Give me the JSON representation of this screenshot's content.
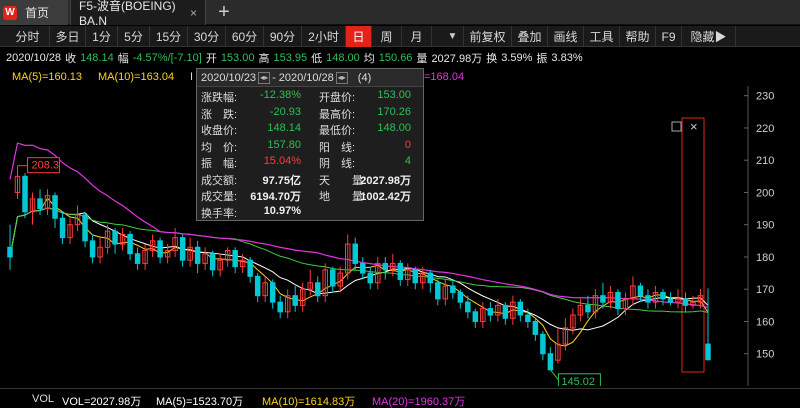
{
  "tabs": [
    {
      "label": "首页",
      "logo": "W"
    },
    {
      "label": "F5-波音(BOEING) BA.N",
      "close": "×"
    }
  ],
  "tab_add": "+",
  "toolbar": [
    {
      "label": "分时"
    },
    {
      "label": "多日"
    },
    {
      "label": "1分"
    },
    {
      "label": "5分"
    },
    {
      "label": "15分"
    },
    {
      "label": "30分"
    },
    {
      "label": "60分"
    },
    {
      "label": "90分"
    },
    {
      "label": "2小时"
    },
    {
      "label": "日",
      "active": true
    },
    {
      "label": "周"
    },
    {
      "label": "月"
    },
    {
      "label": "▼"
    },
    {
      "label": "前复权"
    },
    {
      "label": "叠加"
    },
    {
      "label": "画线"
    },
    {
      "label": "工具"
    },
    {
      "label": "帮助"
    },
    {
      "label": "F9"
    },
    {
      "label": "隐藏▶"
    }
  ],
  "quote": {
    "date": "2020/10/28",
    "close_label": "收",
    "close": "148.14",
    "change_label": "幅",
    "change": "-4.57%/[-7.10]",
    "open_label": "开",
    "open": "153.00",
    "high_label": "高",
    "high": "153.95",
    "low_label": "低",
    "low": "148.00",
    "avg_label": "均",
    "avg": "150.66",
    "vol_label": "量",
    "vol": "2027.98万",
    "turnover_label": "换",
    "turnover": "3.59%",
    "amp_label": "振",
    "amp": "3.83%"
  },
  "ma": {
    "ma5": "MA(5)=160.13",
    "ma10": "MA(10)=163.04",
    "ma_hidden_prefix": "I",
    "ma20": "=168.04"
  },
  "popup": {
    "range_start": "2020/10/23",
    "range_end": "2020/10/28",
    "dash": "-",
    "count": "(4)",
    "rows": [
      {
        "k1": "涨跌幅:",
        "v1": "-12.38%",
        "c1": "g",
        "k2": "开盘价:",
        "v2": "153.00",
        "c2": "g"
      },
      {
        "k1": "涨　跌:",
        "v1": "-20.93",
        "c1": "g",
        "k2": "最高价:",
        "v2": "170.26",
        "c2": "g"
      },
      {
        "k1": "收盘价:",
        "v1": "148.14",
        "c1": "g",
        "k2": "最低价:",
        "v2": "148.00",
        "c2": "g"
      },
      {
        "k1": "均　价:",
        "v1": "157.80",
        "c1": "g",
        "k2": "阳　线:",
        "v2": "0",
        "c2": "r"
      },
      {
        "k1": "振　幅:",
        "v1": "15.04%",
        "c1": "r",
        "k2": "阴　线:",
        "v2": "4",
        "c2": "g"
      },
      {
        "k1": "成交额:",
        "v1": "97.75亿",
        "c1": "w",
        "k2": "天　　量:",
        "v2": "2027.98万",
        "c2": "w"
      },
      {
        "k1": "成交量:",
        "v1": "6194.70万",
        "c1": "w",
        "k2": "地　　量:",
        "v2": "1002.42万",
        "c2": "w"
      },
      {
        "k1": "换手率:",
        "v1": "10.97%",
        "c1": "w",
        "k2": "",
        "v2": "",
        "c2": "w"
      }
    ]
  },
  "vol": {
    "label": "VOL",
    "vol": "VOL=2027.98万",
    "ma5": "MA(5)=1523.70万",
    "ma10": "MA(10)=1614.83万",
    "ma20": "MA(20)=1960.37万"
  },
  "colors": {
    "up": "#ff3b3b",
    "down": "#00c8d4",
    "ma5": "#ffffff",
    "ma10": "#ffd21f",
    "ma20": "#e633e6",
    "ma60": "#3fcf3f",
    "accent": "#e2231a"
  },
  "chart_data": {
    "type": "candlestick",
    "ylim": [
      140,
      233
    ],
    "yticks": [
      150,
      160,
      170,
      180,
      190,
      200,
      210,
      220,
      230
    ],
    "high_label": "208.3",
    "low_label": "145.02",
    "selection_icons": [
      "□",
      "×"
    ],
    "candles": [
      [
        183,
        180,
        190,
        176
      ],
      [
        200,
        205,
        208.3,
        198
      ],
      [
        205,
        194,
        206,
        192
      ],
      [
        194,
        198,
        200,
        190
      ],
      [
        198,
        195,
        201,
        193
      ],
      [
        195,
        199,
        201,
        193
      ],
      [
        199,
        192,
        200,
        189
      ],
      [
        192,
        186,
        194,
        184
      ],
      [
        186,
        190,
        192,
        184
      ],
      [
        190,
        193,
        196,
        188
      ],
      [
        193,
        185,
        194,
        183
      ],
      [
        185,
        180,
        187,
        178
      ],
      [
        180,
        183,
        186,
        178
      ],
      [
        183,
        188,
        190,
        181
      ],
      [
        188,
        184,
        189,
        181
      ],
      [
        184,
        187,
        189,
        182
      ],
      [
        187,
        181,
        188,
        179
      ],
      [
        181,
        178,
        183,
        176
      ],
      [
        178,
        182,
        184,
        176
      ],
      [
        182,
        185,
        187,
        180
      ],
      [
        185,
        180,
        186,
        178
      ],
      [
        180,
        182,
        184,
        178
      ],
      [
        182,
        186,
        189,
        180
      ],
      [
        186,
        179,
        187,
        177
      ],
      [
        179,
        183,
        186,
        177
      ],
      [
        183,
        178,
        185,
        175
      ],
      [
        178,
        181,
        183,
        176
      ],
      [
        181,
        176,
        182,
        174
      ],
      [
        176,
        179,
        181,
        174
      ],
      [
        179,
        182,
        183,
        177
      ],
      [
        182,
        177,
        183,
        175
      ],
      [
        177,
        179,
        181,
        175
      ],
      [
        179,
        174,
        180,
        172
      ],
      [
        174,
        168,
        175,
        166
      ],
      [
        168,
        172,
        174,
        166
      ],
      [
        172,
        166,
        173,
        164
      ],
      [
        166,
        163,
        168,
        161
      ],
      [
        163,
        168,
        170,
        161
      ],
      [
        168,
        165,
        171,
        163
      ],
      [
        165,
        170,
        172,
        163
      ],
      [
        170,
        172,
        176,
        168
      ],
      [
        172,
        168,
        174,
        166
      ],
      [
        168,
        176,
        178,
        166
      ],
      [
        176,
        171,
        177,
        169
      ],
      [
        171,
        175,
        177,
        169
      ],
      [
        175,
        184,
        187,
        173
      ],
      [
        184,
        178,
        186,
        176
      ],
      [
        178,
        175,
        180,
        173
      ],
      [
        175,
        172,
        177,
        170
      ],
      [
        172,
        178,
        180,
        170
      ],
      [
        178,
        176,
        180,
        173
      ],
      [
        176,
        178,
        181,
        174
      ],
      [
        178,
        173,
        179,
        171
      ],
      [
        173,
        176,
        178,
        171
      ],
      [
        176,
        172,
        177,
        170
      ],
      [
        172,
        175,
        177,
        170
      ],
      [
        175,
        172,
        176,
        169
      ],
      [
        172,
        167,
        173,
        165
      ],
      [
        167,
        171,
        173,
        165
      ],
      [
        171,
        169,
        173,
        167
      ],
      [
        169,
        166,
        170,
        164
      ],
      [
        166,
        163,
        168,
        161
      ],
      [
        163,
        160,
        164,
        158
      ],
      [
        160,
        164,
        166,
        158
      ],
      [
        164,
        162,
        166,
        160
      ],
      [
        162,
        165,
        167,
        160
      ],
      [
        165,
        161,
        166,
        159
      ],
      [
        161,
        166,
        168,
        159
      ],
      [
        166,
        162,
        167,
        160
      ],
      [
        162,
        160,
        164,
        158
      ],
      [
        160,
        156,
        161,
        154
      ],
      [
        156,
        150,
        157,
        148
      ],
      [
        150,
        145.02,
        152,
        145.02
      ],
      [
        148,
        153,
        158,
        147
      ],
      [
        153,
        158,
        161,
        151
      ],
      [
        158,
        162,
        164,
        156
      ],
      [
        162,
        165,
        167,
        160
      ],
      [
        165,
        163,
        168,
        161
      ],
      [
        163,
        168,
        170,
        161
      ],
      [
        168,
        166,
        172,
        164
      ],
      [
        166,
        169,
        171,
        164
      ],
      [
        169,
        164,
        170,
        162
      ],
      [
        164,
        167,
        169,
        162
      ],
      [
        167,
        171,
        174,
        165
      ],
      [
        171,
        168,
        172,
        166
      ],
      [
        168,
        166,
        170,
        164
      ],
      [
        166,
        169,
        171,
        164
      ],
      [
        169,
        167,
        170,
        165
      ],
      [
        167,
        166,
        169,
        165
      ],
      [
        166,
        167,
        170,
        164
      ],
      [
        167,
        165,
        169,
        163
      ],
      [
        165,
        166,
        168,
        164
      ],
      [
        166,
        168,
        170,
        164
      ],
      [
        153,
        148.14,
        170.26,
        148
      ]
    ]
  }
}
